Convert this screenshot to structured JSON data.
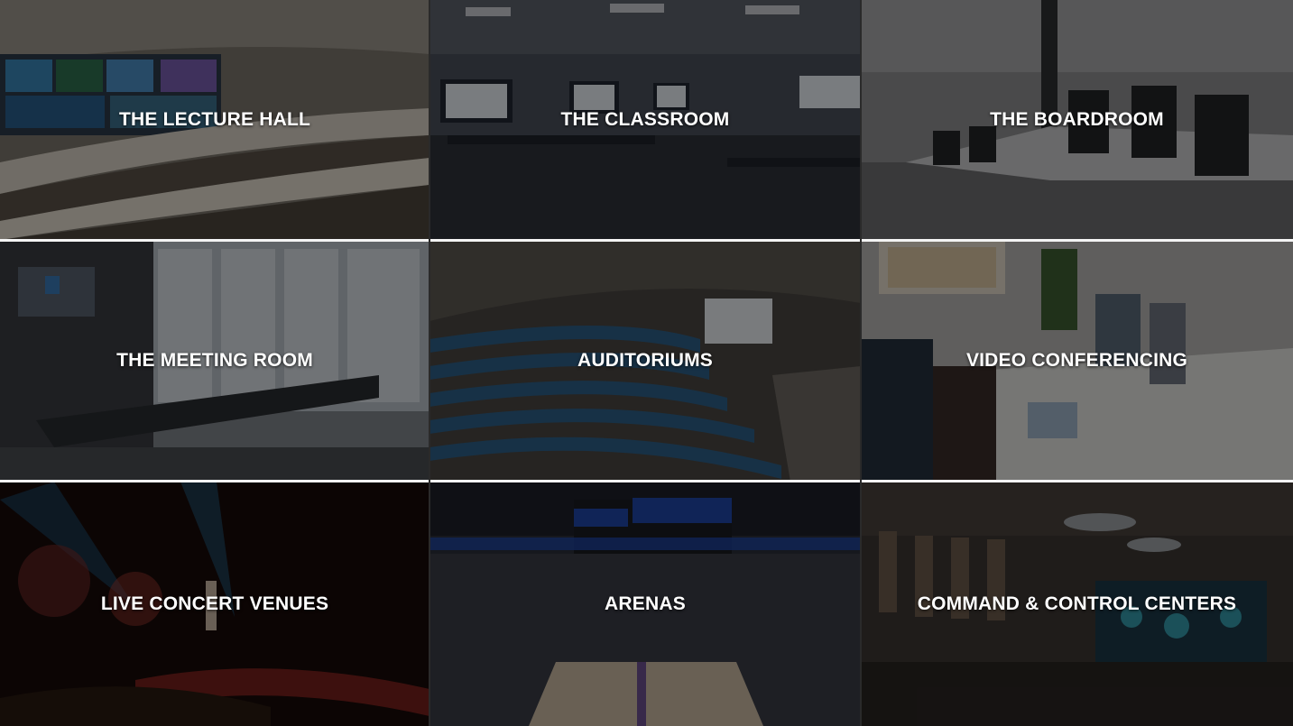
{
  "tiles": [
    {
      "label": "THE LECTURE HALL",
      "bg": "#6d6a63"
    },
    {
      "label": "THE CLASSROOM",
      "bg": "#3f4550"
    },
    {
      "label": "THE BOARDROOM",
      "bg": "#77777a"
    },
    {
      "label": "THE MEETING ROOM",
      "bg": "#6a6f76"
    },
    {
      "label": "AUDITORIUMS",
      "bg": "#4e4a45"
    },
    {
      "label": "VIDEO CONFERENCING",
      "bg": "#8a8a8c"
    },
    {
      "label": "LIVE CONCERT VENUES",
      "bg": "#1a0d0c"
    },
    {
      "label": "ARENAS",
      "bg": "#242833"
    },
    {
      "label": "COMMAND & CONTROL CENTERS",
      "bg": "#3b3532"
    }
  ],
  "accents": {
    "screen_blue": "#3f8ec7",
    "seat_blue": "#2d5f87",
    "arena_brand_blue": "#1f46a8",
    "concert_red": "#c2332a",
    "control_cyan": "#3ec3d6"
  }
}
